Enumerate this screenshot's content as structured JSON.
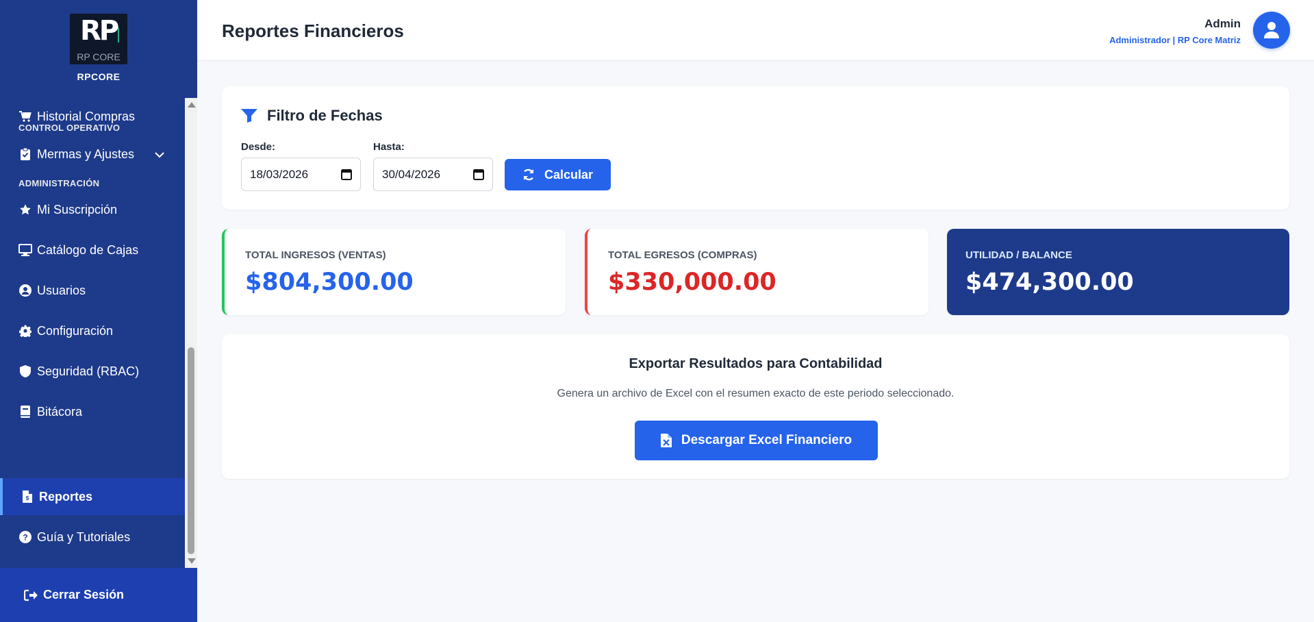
{
  "brand": {
    "logo_text": "RP",
    "logo_sub": "RP CORE",
    "name": "RPCORE"
  },
  "sidebar": {
    "items": [
      {
        "label": "Historial Compras",
        "icon": "cart-icon"
      },
      {
        "section": "CONTROL OPERATIVO"
      },
      {
        "label": "Mermas y Ajustes",
        "icon": "clipboard-icon",
        "expandable": true
      },
      {
        "section": "ADMINISTRACIÓN"
      },
      {
        "label": "Mi Suscripción",
        "icon": "star-icon"
      },
      {
        "label": "Catálogo de Cajas",
        "icon": "monitor-icon"
      },
      {
        "label": "Usuarios",
        "icon": "user-circle-icon"
      },
      {
        "label": "Configuración",
        "icon": "gear-icon"
      },
      {
        "label": "Seguridad (RBAC)",
        "icon": "shield-icon"
      },
      {
        "label": "Bitácora",
        "icon": "book-icon"
      },
      {
        "label": "Reportes",
        "icon": "file-invoice-icon",
        "active": true
      },
      {
        "label": "Guía y Tutoriales",
        "icon": "question-circle-icon"
      }
    ],
    "logout_label": "Cerrar Sesión"
  },
  "header": {
    "title": "Reportes Financieros",
    "user_name": "Admin",
    "user_role": "Administrador | RP Core Matriz"
  },
  "filter": {
    "title": "Filtro de Fechas",
    "from_label": "Desde:",
    "from_value": "18/03/2026",
    "to_label": "Hasta:",
    "to_value": "30/04/2026",
    "button_label": "Calcular"
  },
  "stats": {
    "income_label": "TOTAL INGRESOS (VENTAS)",
    "income_value": "$804,300.00",
    "expense_label": "TOTAL EGRESOS (COMPRAS)",
    "expense_value": "$330,000.00",
    "balance_label": "UTILIDAD / BALANCE",
    "balance_value": "$474,300.00"
  },
  "export": {
    "title": "Exportar Resultados para Contabilidad",
    "description": "Genera un archivo de Excel con el resumen exacto de este periodo seleccionado.",
    "button_label": "Descargar Excel Financiero"
  },
  "colors": {
    "sidebar_bg": "#1e3a8a",
    "primary": "#2563eb",
    "income": "#2563eb",
    "expense": "#dc2626",
    "balance_bg": "#1e3a8a"
  }
}
